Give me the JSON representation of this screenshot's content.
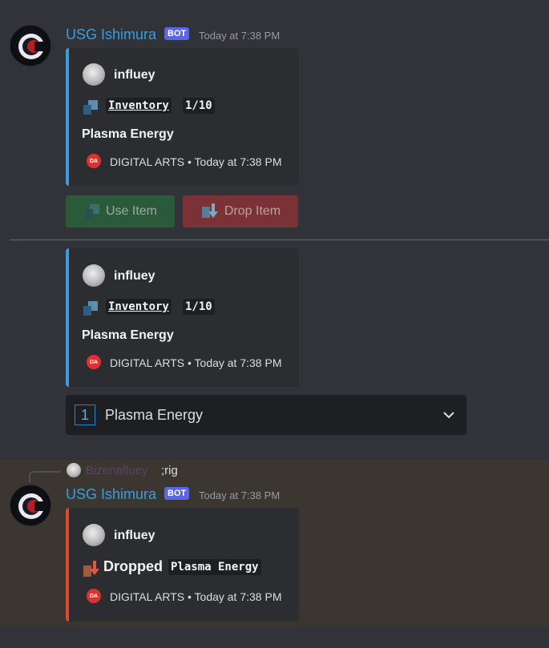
{
  "message1": {
    "username": "USG Ishimura",
    "bot_tag": "BOT",
    "timestamp": "Today at 7:38 PM",
    "embed": {
      "author": "influey",
      "inventory_label": "Inventory",
      "inventory_count": "1/10",
      "item": "Plasma Energy",
      "footer_icon_text": "DA",
      "footer": "DIGITAL ARTS • Today at 7:38 PM"
    },
    "buttons": {
      "use": "Use Item",
      "drop": "Drop Item"
    }
  },
  "message2": {
    "embed": {
      "author": "influey",
      "inventory_label": "Inventory",
      "inventory_count": "1/10",
      "item": "Plasma Energy",
      "footer_icon_text": "DA",
      "footer": "DIGITAL ARTS • Today at 7:38 PM"
    },
    "select": {
      "number": "1",
      "value": "Plasma Energy"
    }
  },
  "message3": {
    "reply": {
      "name": "Bizenafluey",
      "text": ";rig"
    },
    "username": "USG Ishimura",
    "bot_tag": "BOT",
    "timestamp": "Today at 7:38 PM",
    "embed": {
      "author": "influey",
      "dropped_label": "Dropped",
      "dropped_item": "Plasma Energy",
      "footer_icon_text": "DA",
      "footer": "DIGITAL ARTS • Today at 7:38 PM"
    }
  },
  "colors": {
    "background": "#313338",
    "embed_bg": "#2b2d31",
    "accent_blue": "#3a9de0",
    "accent_red": "#e3452d",
    "bot_tag": "#5865f2",
    "highlight_band": "#3b3730"
  },
  "icons": [
    "bot-avatar-icon",
    "author-avatar-icon",
    "inventory-icon",
    "drop-icon",
    "chevron-down-icon",
    "digital-arts-icon",
    "number-1-icon"
  ]
}
